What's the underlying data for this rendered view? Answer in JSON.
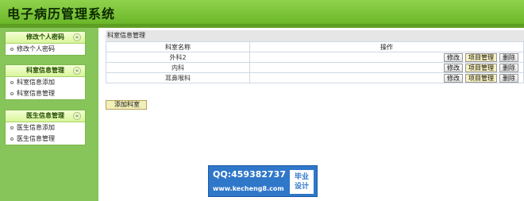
{
  "app": {
    "title": "电子病历管理系统"
  },
  "sidebar": {
    "toggle_glyph": "«",
    "groups": [
      {
        "title": "修改个人密码",
        "items": [
          {
            "label": "修改个人密码"
          }
        ]
      },
      {
        "title": "科室信息管理",
        "items": [
          {
            "label": "科室信息添加"
          },
          {
            "label": "科室信息管理"
          }
        ]
      },
      {
        "title": "医生信息管理",
        "items": [
          {
            "label": "医生信息添加"
          },
          {
            "label": "医生信息管理"
          }
        ]
      }
    ]
  },
  "main": {
    "caption": "科室信息管理",
    "columns": [
      "科室名称",
      "操作"
    ],
    "rows": [
      {
        "name": "外科2"
      },
      {
        "name": "内科"
      },
      {
        "name": "耳鼻喉科"
      }
    ],
    "actions": {
      "edit": "修改",
      "projects": "项目管理",
      "delete": "删除"
    },
    "add_label": "添加科室"
  },
  "watermark": {
    "qq": "QQ:459382737",
    "site": "www.kecheng8.com",
    "badge_line1": "毕业",
    "badge_line2": "设计"
  }
}
